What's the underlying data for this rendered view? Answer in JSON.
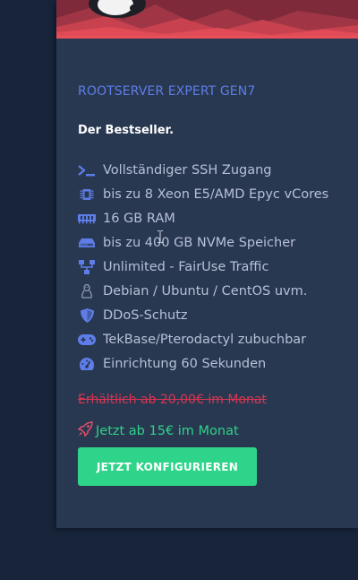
{
  "plan": {
    "title": "ROOTSERVER EXPERT GEN7",
    "subtitle": "Der Bestseller.",
    "features": [
      {
        "icon": "terminal-icon",
        "label": "Vollständiger SSH Zugang"
      },
      {
        "icon": "cpu-icon",
        "label": "bis zu 8 Xeon E5/AMD Epyc vCores"
      },
      {
        "icon": "memory-icon",
        "label": "16 GB RAM"
      },
      {
        "icon": "hdd-icon",
        "label": "bis zu 400 GB NVMe Speicher"
      },
      {
        "icon": "network-icon",
        "label": "Unlimited - FairUse Traffic"
      },
      {
        "icon": "linux-icon",
        "label": "Debian / Ubuntu / CentOS uvm."
      },
      {
        "icon": "shield-icon",
        "label": "DDoS-Schutz"
      },
      {
        "icon": "gamepad-icon",
        "label": "TekBase/Pterodactyl zubuchbar"
      },
      {
        "icon": "tachometer-icon",
        "label": "Einrichtung 60 Sekunden"
      }
    ],
    "old_price": "Erhältlich ab 20,00€ im Monat",
    "new_price": "Jetzt ab 15€ im Monat",
    "new_price_icon": "rocket-icon",
    "cta_label": "JETZT KONFIGURIEREN"
  },
  "colors": {
    "page_bg": "#17243a",
    "card_bg": "#283850",
    "accent_blue": "#5e7de8",
    "feature_text": "#b7c1d6",
    "old_price": "#dc3452",
    "new_price": "#2fd28a",
    "cta_bg": "#2dd489"
  }
}
